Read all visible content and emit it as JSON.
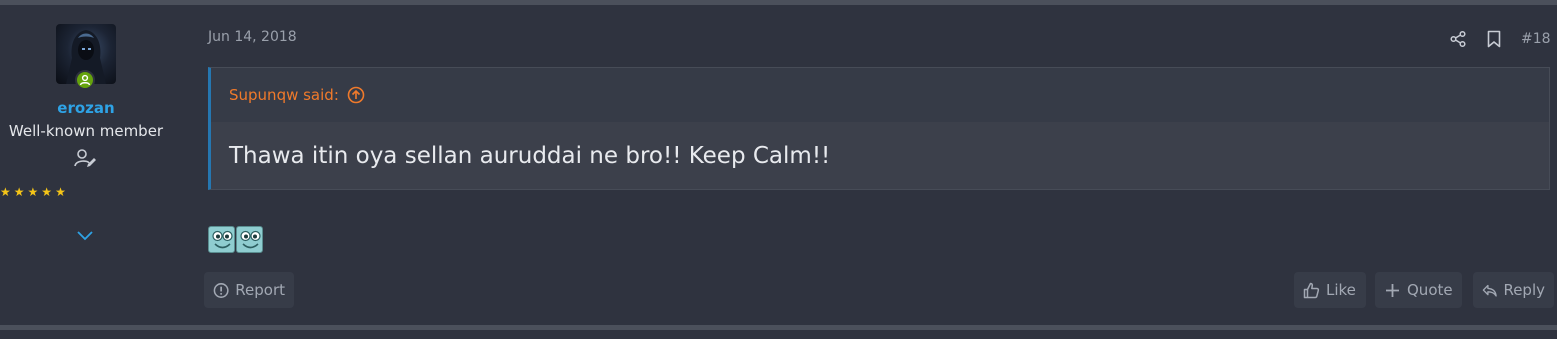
{
  "post": {
    "date": "Jun 14, 2018",
    "number": "#18",
    "author": {
      "username": "erozan",
      "title": "Well-known member",
      "online": true,
      "rating_stars": 5
    },
    "quote": {
      "attribution": "Supunqw said:",
      "text": "Thawa itin oya sellan auruddai ne bro!! Keep Calm!!"
    },
    "smilies": [
      "smiley-icon",
      "smiley-icon"
    ],
    "actions": {
      "report_label": "Report",
      "like_label": "Like",
      "quote_label": "Quote",
      "reply_label": "Reply"
    }
  },
  "colors": {
    "background": "#2f333f",
    "username": "#2ea3e6",
    "quote_attribution": "#f07a2b",
    "quote_border": "#2577b1",
    "star": "#f5c518",
    "online": "#65a30d"
  }
}
